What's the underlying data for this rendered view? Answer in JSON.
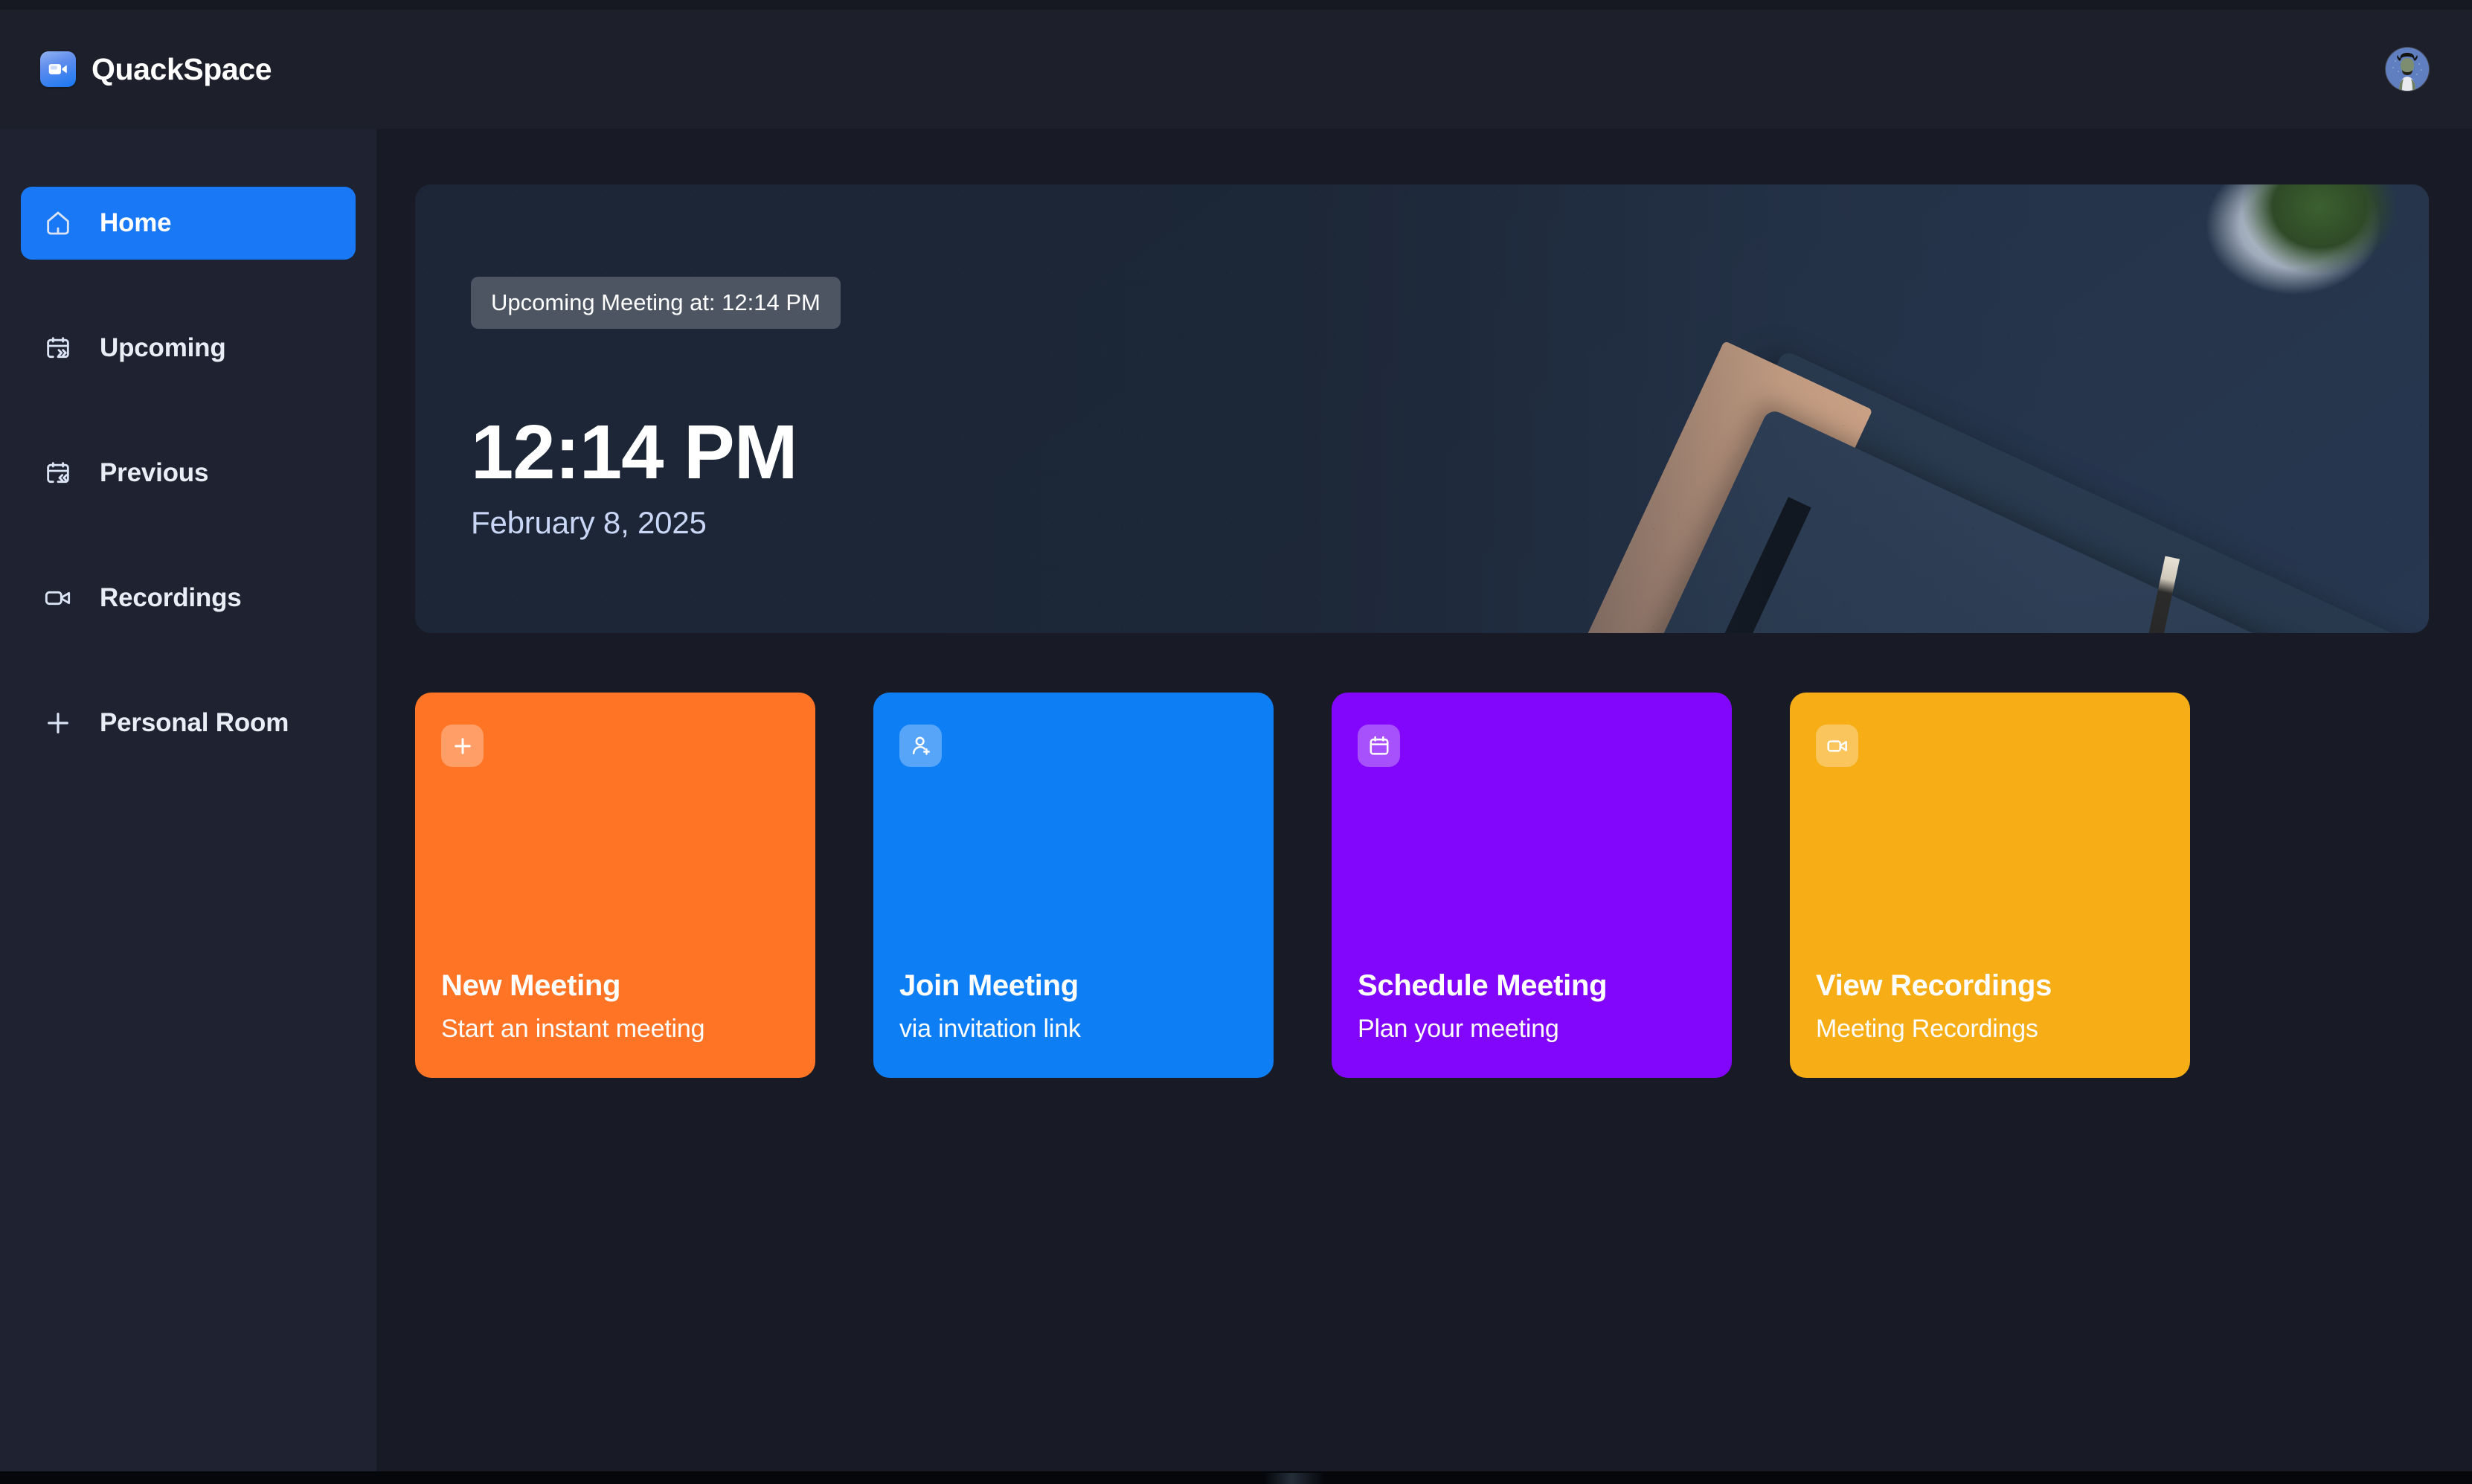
{
  "app": {
    "brand_name": "QuackSpace",
    "logo_icon": "video-camera-icon",
    "avatar_icon": "user-avatar"
  },
  "sidebar": {
    "items": [
      {
        "label": "Home",
        "icon": "home-icon",
        "active": true
      },
      {
        "label": "Upcoming",
        "icon": "calendar-forward-icon",
        "active": false
      },
      {
        "label": "Previous",
        "icon": "calendar-back-icon",
        "active": false
      },
      {
        "label": "Recordings",
        "icon": "video-camera-icon",
        "active": false
      },
      {
        "label": "Personal Room",
        "icon": "plus-icon",
        "active": false
      }
    ],
    "active_color": "#1878f5"
  },
  "hero": {
    "badge": "Upcoming Meeting at: 12:14 PM",
    "time": "12:14 PM",
    "date": "February 8, 2025"
  },
  "cards": [
    {
      "title": "New Meeting",
      "subtitle": "Start an instant meeting",
      "icon": "plus-icon",
      "color": "#ff7425"
    },
    {
      "title": "Join Meeting",
      "subtitle": "via invitation link",
      "icon": "person-add-icon",
      "color": "#0e7ef5"
    },
    {
      "title": "Schedule Meeting",
      "subtitle": "Plan your meeting",
      "icon": "calendar-icon",
      "color": "#8206fb"
    },
    {
      "title": "View Recordings",
      "subtitle": "Meeting Recordings",
      "icon": "video-camera-icon",
      "color": "#f6ad16"
    }
  ]
}
